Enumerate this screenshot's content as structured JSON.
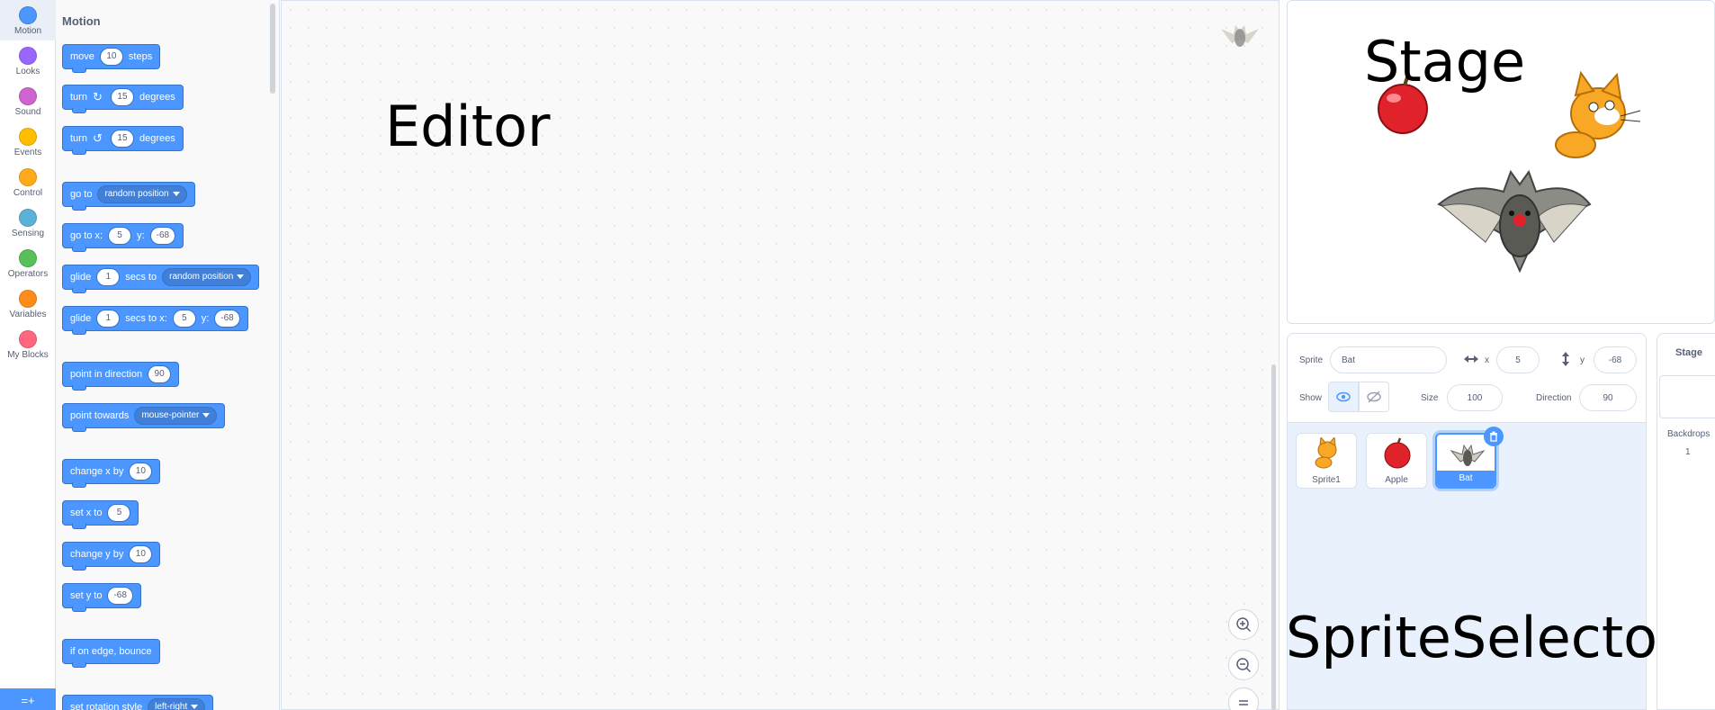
{
  "categories": [
    {
      "label": "Motion",
      "color": "#4c97ff",
      "icon": "motion-icon"
    },
    {
      "label": "Looks",
      "color": "#9966ff",
      "icon": "looks-icon"
    },
    {
      "label": "Sound",
      "color": "#cf63cf",
      "icon": "sound-icon"
    },
    {
      "label": "Events",
      "color": "#ffbf00",
      "icon": "events-icon"
    },
    {
      "label": "Control",
      "color": "#ffab19",
      "icon": "control-icon"
    },
    {
      "label": "Sensing",
      "color": "#5cb1d6",
      "icon": "sensing-icon"
    },
    {
      "label": "Operators",
      "color": "#59c059",
      "icon": "operators-icon"
    },
    {
      "label": "Variables",
      "color": "#ff8c1a",
      "icon": "variables-icon"
    },
    {
      "label": "My Blocks",
      "color": "#ff6680",
      "icon": "my-blocks-icon"
    }
  ],
  "palette": {
    "title": "Motion",
    "blocks": {
      "move": {
        "a": "move",
        "v": "10",
        "b": "steps"
      },
      "turn_right": {
        "a": "turn",
        "v": "15",
        "b": "degrees"
      },
      "turn_left": {
        "a": "turn",
        "v": "15",
        "b": "degrees"
      },
      "goto": {
        "a": "go to",
        "d": "random position"
      },
      "goto_xy": {
        "a": "go to x:",
        "x": "5",
        "b": "y:",
        "y": "-68"
      },
      "glide_to": {
        "a": "glide",
        "v": "1",
        "b": "secs to",
        "d": "random position"
      },
      "glide_xy": {
        "a": "glide",
        "v": "1",
        "b": "secs to x:",
        "x": "5",
        "c": "y:",
        "y": "-68"
      },
      "point_dir": {
        "a": "point in direction",
        "v": "90"
      },
      "point_towards": {
        "a": "point towards",
        "d": "mouse-pointer"
      },
      "change_x": {
        "a": "change x by",
        "v": "10"
      },
      "set_x": {
        "a": "set x to",
        "v": "5"
      },
      "change_y": {
        "a": "change y by",
        "v": "10"
      },
      "set_y": {
        "a": "set y to",
        "v": "-68"
      },
      "bounce": {
        "a": "if on edge, bounce"
      },
      "rotation": {
        "a": "set rotation style",
        "d": "left-right"
      }
    }
  },
  "editor": {
    "overlay_label": "Editor"
  },
  "stage": {
    "overlay_label": "Stage"
  },
  "sprite_info": {
    "sprite_label": "Sprite",
    "sprite_name": "Bat",
    "x_label": "x",
    "x_value": "5",
    "y_label": "y",
    "y_value": "-68",
    "show_label": "Show",
    "size_label": "Size",
    "size_value": "100",
    "direction_label": "Direction",
    "direction_value": "90"
  },
  "sprites": [
    {
      "name": "Sprite1"
    },
    {
      "name": "Apple"
    },
    {
      "name": "Bat"
    }
  ],
  "sprite_selector": {
    "overlay_label": "SpriteSelector"
  },
  "stage_pane": {
    "title": "Stage",
    "backdrops_label": "Backdrops",
    "backdrops_count": "1"
  }
}
